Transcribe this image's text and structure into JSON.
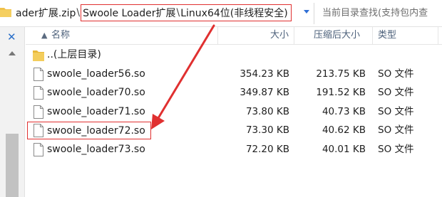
{
  "address_bar": {
    "crumbs": [
      "ader扩展.zip",
      "Swoole Loader扩展",
      "Linux64位(非线程安全)"
    ],
    "separator": "\\",
    "search_placeholder": "当前目录查找(支持包内查"
  },
  "columns": {
    "name": "名称",
    "size": "大小",
    "compressed_size": "压缩后大小",
    "type": "类型"
  },
  "rows": [
    {
      "name": "..(上层目录)",
      "size": "",
      "compressed_size": "",
      "type": "",
      "icon": "folder-icon"
    },
    {
      "name": "swoole_loader56.so",
      "size": "354.23 KB",
      "compressed_size": "213.75 KB",
      "type": "SO 文件",
      "icon": "file-icon"
    },
    {
      "name": "swoole_loader70.so",
      "size": "349.87 KB",
      "compressed_size": "191.52 KB",
      "type": "SO 文件",
      "icon": "file-icon"
    },
    {
      "name": "swoole_loader71.so",
      "size": "73.80 KB",
      "compressed_size": "40.73 KB",
      "type": "SO 文件",
      "icon": "file-icon"
    },
    {
      "name": "swoole_loader72.so",
      "size": "73.30 KB",
      "compressed_size": "40.62 KB",
      "type": "SO 文件",
      "icon": "file-icon",
      "highlighted": true
    },
    {
      "name": "swoole_loader73.so",
      "size": "72.20 KB",
      "compressed_size": "40.01 KB",
      "type": "SO 文件",
      "icon": "file-icon"
    }
  ],
  "colors": {
    "annotation": "#e03030",
    "folder": "#f0c14b",
    "accent": "#2a6fc9"
  }
}
